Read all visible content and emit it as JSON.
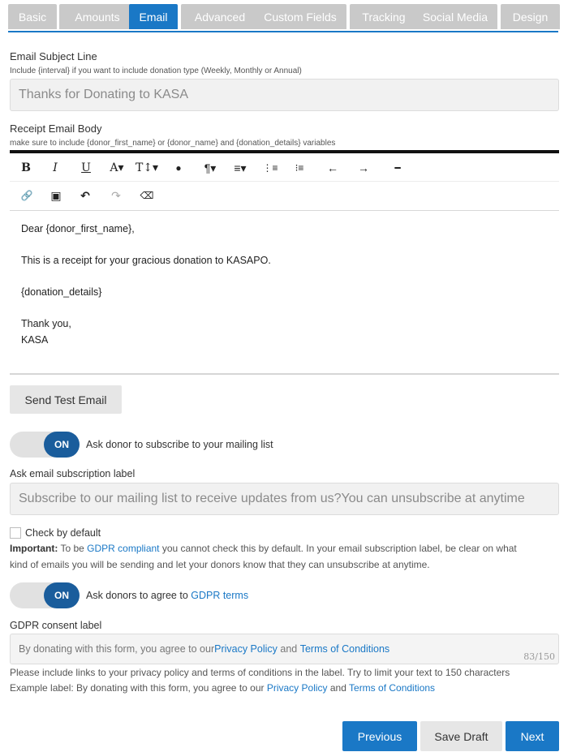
{
  "tabs": [
    {
      "label": "Basic"
    },
    {
      "label": "Amounts"
    },
    {
      "label": "Email"
    },
    {
      "label": "Advanced"
    },
    {
      "label": "Custom Fields"
    },
    {
      "label": "Tracking"
    },
    {
      "label": "Social Media"
    },
    {
      "label": "Design"
    }
  ],
  "active_tab": "Email",
  "subject": {
    "label": "Email Subject Line",
    "hint": "Include {interval} if you want to include donation type (Weekly, Monthly or Annual)",
    "value": "Thanks for Donating to KASA"
  },
  "receipt": {
    "label": "Receipt Email Body",
    "hint": "make sure to include {donor_first_name} or {donor_name} and {donation_details} variables",
    "lines": [
      "Dear {donor_first_name},",
      "This is a receipt for your gracious donation to KASAPO.",
      "{donation_details}",
      "Thank you,",
      "KASA"
    ]
  },
  "toolbar": {
    "bold": "B",
    "italic": "I",
    "underline": "U",
    "font_color": "A▾",
    "text_size": "T↕▾",
    "highlight": "●",
    "paragraph": "¶▾",
    "align": "≡▾",
    "ordered_list": "⋮≡",
    "bullet_list": "⁝≡",
    "outdent": "←",
    "indent": "→",
    "hr": "━",
    "link": "🔗",
    "image": "▣",
    "undo": "↶",
    "redo": "↷",
    "eraser": "⌫"
  },
  "send_test_label": "Send Test Email",
  "subscribe": {
    "toggle_state": "ON",
    "toggle_label": "Ask donor to subscribe to your mailing list",
    "field_label": "Ask email subscription label",
    "value": "Subscribe to our mailing list to receive updates from us?You can unsubscribe at anytime",
    "checkbox_label": "Check by default",
    "important_prefix": "Important:",
    "important_text_1": " To be ",
    "important_link": "GDPR compliant",
    "important_text_2": " you cannot check this by default. In your email subscription label, be clear on what",
    "important_line2": "kind of emails you will be sending and let your donors know that they can unsubscribe at anytime."
  },
  "gdpr": {
    "toggle_state": "ON",
    "toggle_label_prefix": "Ask donors to agree to ",
    "toggle_label_link": "GDPR terms",
    "field_label": "GDPR consent label",
    "value_prefix": "By donating with this form, you agree to our ",
    "value_link1": "Privacy Policy",
    "value_and": " and ",
    "value_link2": "Terms of Conditions",
    "counter": "83/150",
    "help_line1": "Please include links to your privacy policy and terms of conditions in the label. Try to limit your text to 150 characters",
    "help_line2_prefix": "Example label: By donating with this form, you agree to our ",
    "help_link1": "Privacy Policy",
    "help_and": " and ",
    "help_link2": "Terms of Conditions"
  },
  "footer": {
    "previous": "Previous",
    "save_draft": "Save Draft",
    "next": "Next"
  },
  "colors": {
    "accent": "#1a78c6",
    "tab_inactive": "#c9c9c9",
    "toggle_knob": "#1a5d9c"
  }
}
